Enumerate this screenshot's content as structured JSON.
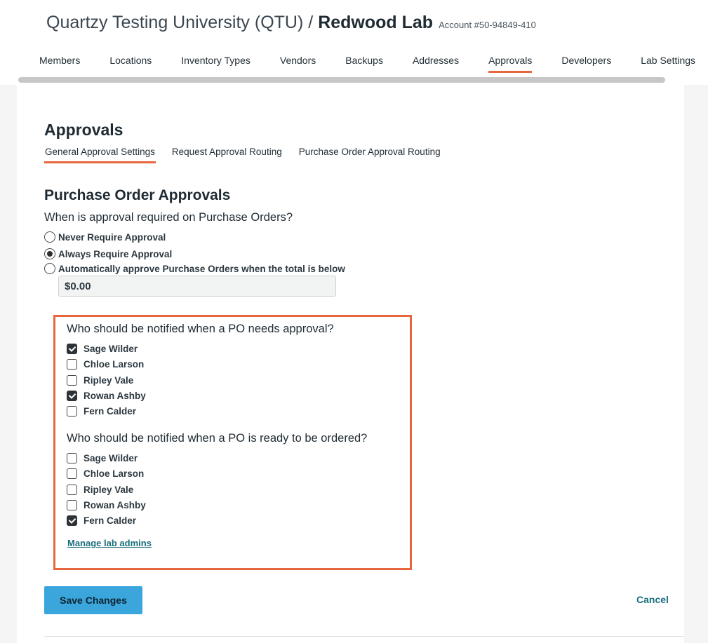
{
  "header": {
    "org_name": "Quartzy Testing University (QTU) /",
    "lab_name": "Redwood Lab",
    "account": "Account #50-94849-410"
  },
  "topnav": {
    "tabs": [
      {
        "label": "Members"
      },
      {
        "label": "Locations"
      },
      {
        "label": "Inventory Types"
      },
      {
        "label": "Vendors"
      },
      {
        "label": "Backups"
      },
      {
        "label": "Addresses"
      },
      {
        "label": "Approvals"
      },
      {
        "label": "Developers"
      },
      {
        "label": "Lab Settings"
      }
    ],
    "active": "Approvals"
  },
  "page": {
    "title": "Approvals",
    "subtabs": [
      {
        "label": "General Approval Settings"
      },
      {
        "label": "Request Approval Routing"
      },
      {
        "label": "Purchase Order Approval Routing"
      }
    ],
    "active_subtab": "General Approval Settings"
  },
  "po_approvals": {
    "heading": "Purchase Order Approvals",
    "question": "When is approval required on Purchase Orders?",
    "options": [
      {
        "label": "Never Require Approval",
        "selected": false
      },
      {
        "label": "Always Require Approval",
        "selected": true
      },
      {
        "label": "Automatically approve Purchase Orders when the total is below",
        "selected": false
      }
    ],
    "threshold_value": "$0.00"
  },
  "notifications": {
    "needs_approval": {
      "question": "Who should be notified when a PO needs approval?",
      "people": [
        {
          "name": "Sage Wilder",
          "checked": true
        },
        {
          "name": "Chloe Larson",
          "checked": false
        },
        {
          "name": "Ripley Vale",
          "checked": false
        },
        {
          "name": "Rowan Ashby",
          "checked": true
        },
        {
          "name": "Fern Calder",
          "checked": false
        }
      ]
    },
    "ready_to_order": {
      "question": "Who should be notified when a PO is ready to be ordered?",
      "people": [
        {
          "name": "Sage Wilder",
          "checked": false
        },
        {
          "name": "Chloe Larson",
          "checked": false
        },
        {
          "name": "Ripley Vale",
          "checked": false
        },
        {
          "name": "Rowan Ashby",
          "checked": false
        },
        {
          "name": "Fern Calder",
          "checked": true
        }
      ]
    },
    "manage_link": "Manage lab admins"
  },
  "actions": {
    "save_label": "Save Changes",
    "cancel_label": "Cancel"
  },
  "colors": {
    "accent": "#e8663d",
    "primary_button": "#3aa6dc",
    "link": "#1a6f7d"
  }
}
